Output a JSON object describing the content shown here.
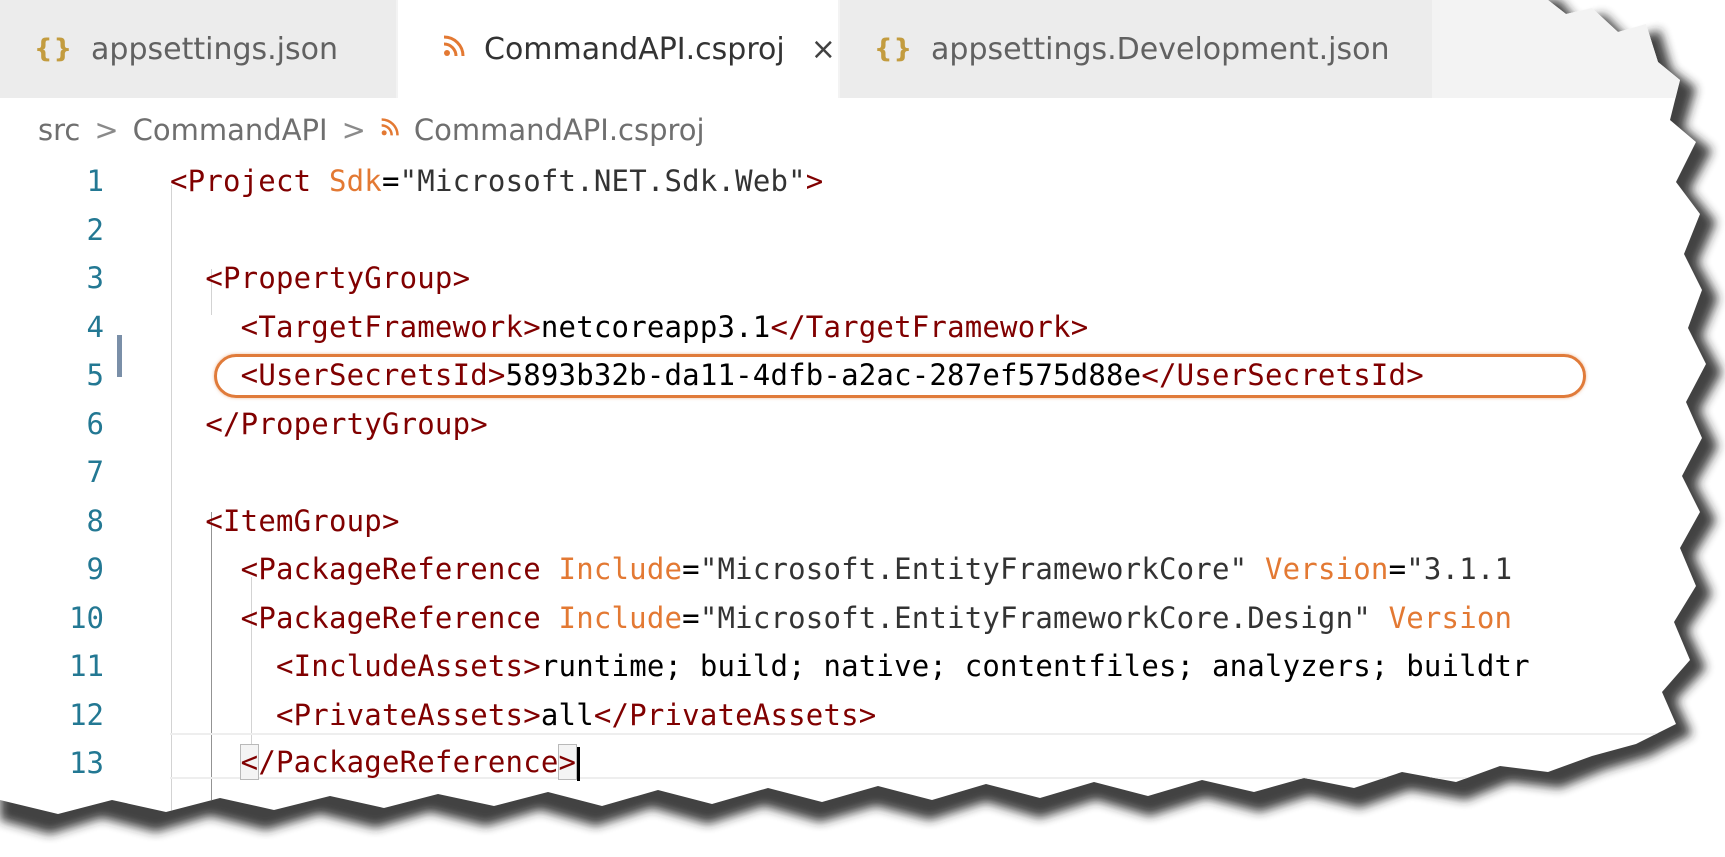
{
  "tabs": [
    {
      "icon": "{}",
      "label": "appsettings.json",
      "active": false
    },
    {
      "icon": "rss",
      "label": "CommandAPI.csproj",
      "active": true,
      "close": "×"
    },
    {
      "icon": "{}",
      "label": "appsettings.Development.json",
      "active": false
    }
  ],
  "breadcrumb": {
    "items": [
      "src",
      "CommandAPI",
      "CommandAPI.csproj"
    ],
    "separator": ">"
  },
  "editor": {
    "lines": [
      {
        "n": "1",
        "tokens": [
          [
            "punct",
            "<"
          ],
          [
            "tag",
            "Project"
          ],
          [
            "txt",
            " "
          ],
          [
            "attr",
            "Sdk"
          ],
          [
            "txt",
            "="
          ],
          [
            "str",
            "\"Microsoft.NET.Sdk.Web\""
          ],
          [
            "punct",
            ">"
          ]
        ]
      },
      {
        "n": "2",
        "tokens": []
      },
      {
        "n": "3",
        "tokens": [
          [
            "txt",
            "  "
          ],
          [
            "punct",
            "<"
          ],
          [
            "tag",
            "PropertyGroup"
          ],
          [
            "punct",
            ">"
          ]
        ]
      },
      {
        "n": "4",
        "tokens": [
          [
            "txt",
            "    "
          ],
          [
            "punct",
            "<"
          ],
          [
            "tag",
            "TargetFramework"
          ],
          [
            "punct",
            ">"
          ],
          [
            "txt",
            "netcoreapp3.1"
          ],
          [
            "punct",
            "</"
          ],
          [
            "tag",
            "TargetFramework"
          ],
          [
            "punct",
            ">"
          ]
        ]
      },
      {
        "n": "5",
        "tokens": [
          [
            "txt",
            "    "
          ],
          [
            "punct",
            "<"
          ],
          [
            "tag",
            "UserSecretsId"
          ],
          [
            "punct",
            ">"
          ],
          [
            "txt",
            "5893b32b-da11-4dfb-a2ac-287ef575d88e"
          ],
          [
            "punct",
            "</"
          ],
          [
            "tag",
            "UserSecretsId"
          ],
          [
            "punct",
            ">"
          ]
        ]
      },
      {
        "n": "6",
        "tokens": [
          [
            "txt",
            "  "
          ],
          [
            "punct",
            "</"
          ],
          [
            "tag",
            "PropertyGroup"
          ],
          [
            "punct",
            ">"
          ]
        ]
      },
      {
        "n": "7",
        "tokens": []
      },
      {
        "n": "8",
        "tokens": [
          [
            "txt",
            "  "
          ],
          [
            "punct",
            "<"
          ],
          [
            "tag",
            "ItemGroup"
          ],
          [
            "punct",
            ">"
          ]
        ]
      },
      {
        "n": "9",
        "tokens": [
          [
            "txt",
            "    "
          ],
          [
            "punct",
            "<"
          ],
          [
            "tag",
            "PackageReference"
          ],
          [
            "txt",
            " "
          ],
          [
            "attr",
            "Include"
          ],
          [
            "txt",
            "="
          ],
          [
            "str",
            "\"Microsoft.EntityFrameworkCore\""
          ],
          [
            "txt",
            " "
          ],
          [
            "attr",
            "Version"
          ],
          [
            "txt",
            "="
          ],
          [
            "str",
            "\"3.1.1"
          ]
        ]
      },
      {
        "n": "10",
        "tokens": [
          [
            "txt",
            "    "
          ],
          [
            "punct",
            "<"
          ],
          [
            "tag",
            "PackageReference"
          ],
          [
            "txt",
            " "
          ],
          [
            "attr",
            "Include"
          ],
          [
            "txt",
            "="
          ],
          [
            "str",
            "\"Microsoft.EntityFrameworkCore.Design\""
          ],
          [
            "txt",
            " "
          ],
          [
            "attr",
            "Version"
          ]
        ]
      },
      {
        "n": "11",
        "tokens": [
          [
            "txt",
            "      "
          ],
          [
            "punct",
            "<"
          ],
          [
            "tag",
            "IncludeAssets"
          ],
          [
            "punct",
            ">"
          ],
          [
            "txt",
            "runtime; build; native; contentfiles; analyzers; buildtr"
          ]
        ]
      },
      {
        "n": "12",
        "tokens": [
          [
            "txt",
            "      "
          ],
          [
            "punct",
            "<"
          ],
          [
            "tag",
            "PrivateAssets"
          ],
          [
            "punct",
            ">"
          ],
          [
            "txt",
            "all"
          ],
          [
            "punct",
            "</"
          ],
          [
            "tag",
            "PrivateAssets"
          ],
          [
            "punct",
            ">"
          ]
        ]
      },
      {
        "n": "13",
        "tokens": [
          [
            "txt",
            "    "
          ],
          [
            "bracket",
            "<"
          ],
          [
            "punct",
            "/"
          ],
          [
            "tag",
            "PackageReference"
          ],
          [
            "bracket",
            ">"
          ]
        ]
      }
    ]
  },
  "annotation": {
    "highlighted_line": "5"
  },
  "colors": {
    "tag": "#800000",
    "attribute": "#e37933",
    "line_number": "#237893",
    "highlight": "#e07b3a"
  }
}
